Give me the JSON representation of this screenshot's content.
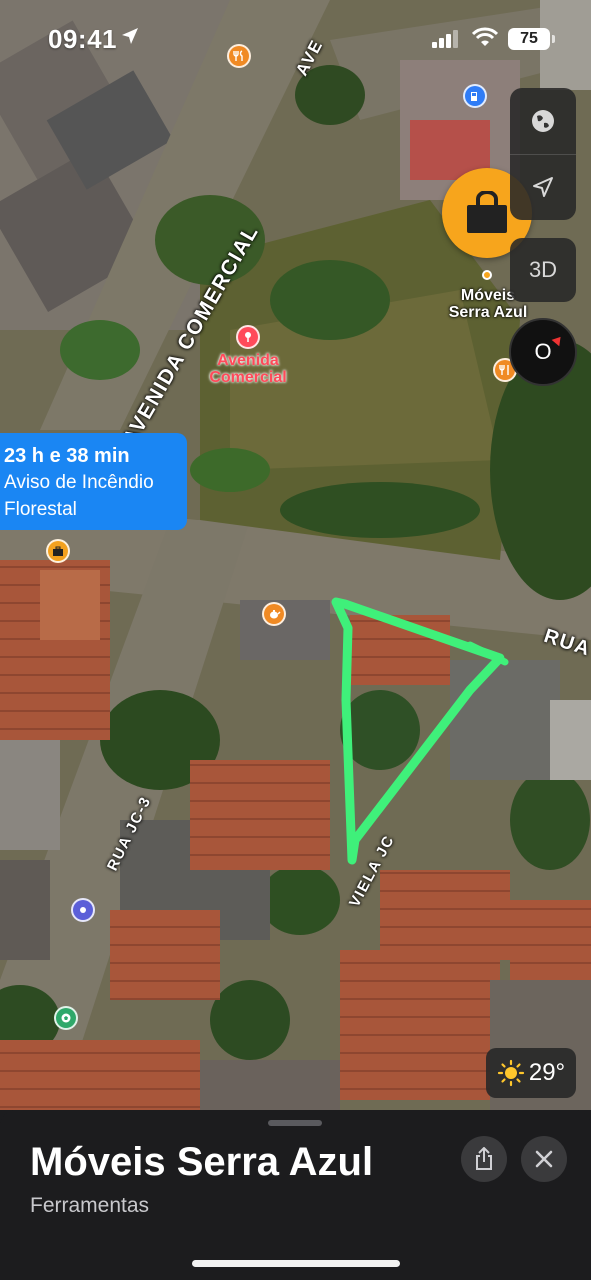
{
  "status_bar": {
    "time": "09:41",
    "battery": "75"
  },
  "map": {
    "poi_main_label": "Móveis Serra Azul",
    "poi_secondary_label_line1": "Avenida",
    "poi_secondary_label_line2": "Comercial",
    "streets": {
      "avenida_comercial": "AVENIDA COMERCIAL",
      "avenida_top": "AVE",
      "rua_right": "RUA",
      "rua_jc3": "RUA JC-3",
      "viela": "VIELA JC"
    },
    "controls": {
      "three_d_label": "3D",
      "compass_label": "O"
    },
    "alert": {
      "eta": "23 h e 38 min",
      "line1": "Aviso de Incêndio",
      "line2": "Florestal"
    },
    "weather": {
      "temperature": "29°"
    }
  },
  "sheet": {
    "title": "Móveis Serra Azul",
    "subtitle": "Ferramentas"
  },
  "colors": {
    "accent_poi": "#f7a51c",
    "alert_blue": "#1a86f3",
    "annotation_green": "#3ff07a",
    "sheet_bg": "#1c1c1e"
  },
  "icons": [
    "location-arrow-icon",
    "signal-icon",
    "wifi-icon",
    "battery-icon",
    "globe-icon",
    "navigation-arrow-icon",
    "shopping-bag-icon",
    "restaurant-icon",
    "gas-station-icon",
    "briefcase-icon",
    "teapot-icon",
    "transit-icon",
    "soccer-icon",
    "pin-icon",
    "sun-icon",
    "share-icon",
    "close-icon"
  ]
}
